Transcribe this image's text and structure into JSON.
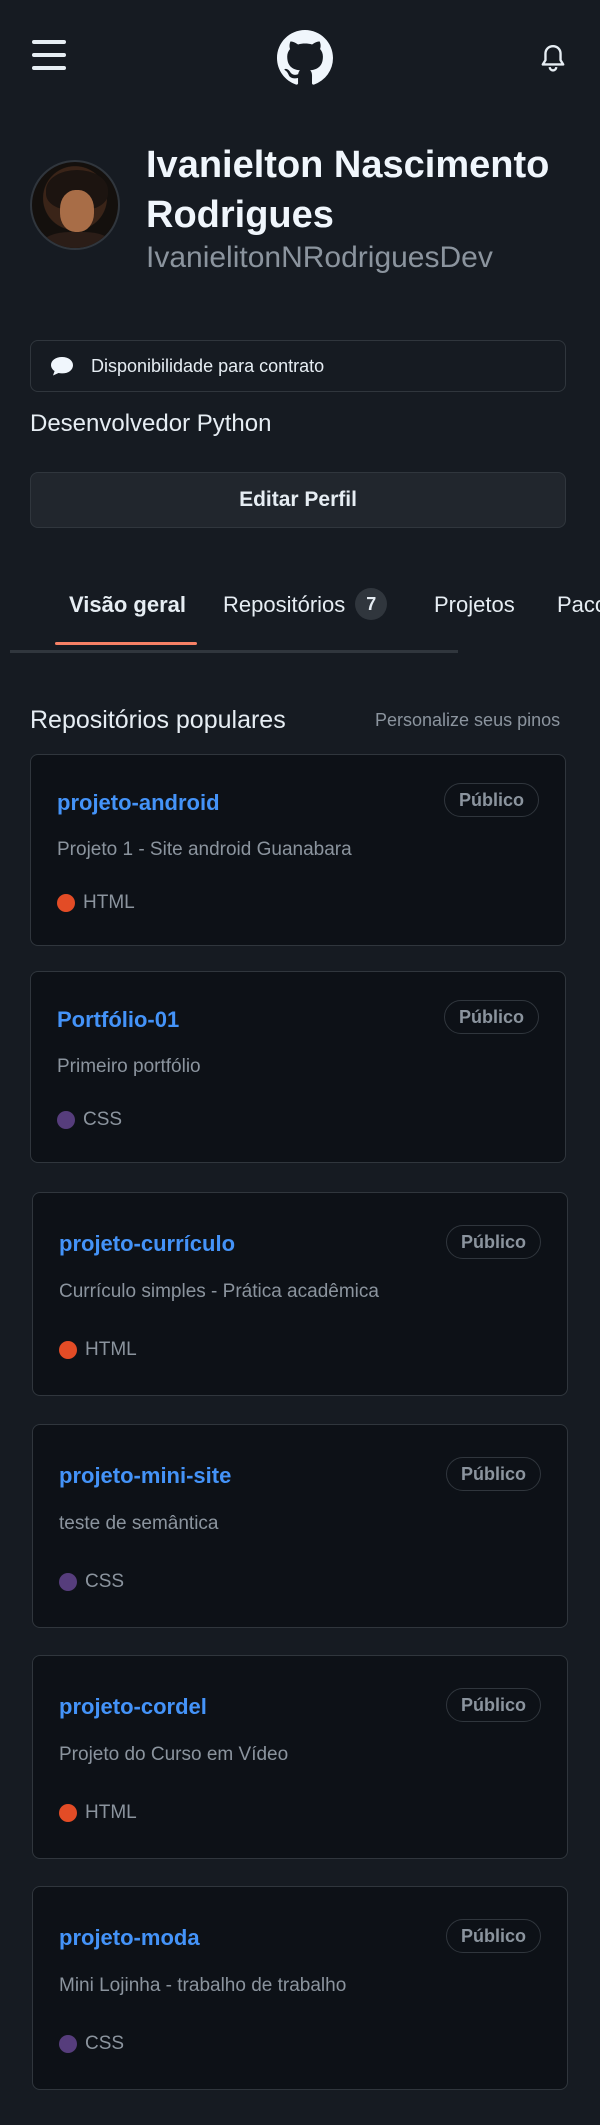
{
  "header": {
    "menu_icon": "hamburger-menu-icon",
    "logo_icon": "github-logo-icon",
    "notifications_icon": "bell-icon"
  },
  "profile": {
    "full_name": "Ivanielton Nascimento Rodrigues",
    "username": "IvanielitonNRodriguesDev",
    "hire_status": "Disponibilidade para contrato",
    "bio": "Desenvolvedor Python",
    "edit_label": "Editar Perfil"
  },
  "tabs": [
    {
      "label": "Visão geral",
      "active": true
    },
    {
      "label": "Repositórios",
      "count": "7"
    },
    {
      "label": "Projetos"
    },
    {
      "label": "Pacotes"
    }
  ],
  "section": {
    "title": "Repositórios populares",
    "customize": "Personalize seus pinos"
  },
  "colors": {
    "accent": "#f78166",
    "link": "#4493f8",
    "html": "#e34c26",
    "css": "#563d7c"
  },
  "repos": [
    {
      "name": "projeto-android",
      "visibility": "Público",
      "description": "Projeto 1 - Site android Guanabara",
      "language": "HTML",
      "lang_color": "#e34c26"
    },
    {
      "name": "Portfólio-01",
      "visibility": "Público",
      "description": "Primeiro portfólio",
      "language": "CSS",
      "lang_color": "#563d7c"
    },
    {
      "name": "projeto-currículo",
      "visibility": "Público",
      "description": "Currículo simples - Prática acadêmica",
      "language": "HTML",
      "lang_color": "#e34c26"
    },
    {
      "name": "projeto-mini-site",
      "visibility": "Público",
      "description": "teste de semântica",
      "language": "CSS",
      "lang_color": "#563d7c"
    },
    {
      "name": "projeto-cordel",
      "visibility": "Público",
      "description": "Projeto do Curso em Vídeo",
      "language": "HTML",
      "lang_color": "#e34c26"
    },
    {
      "name": "projeto-moda",
      "visibility": "Público",
      "description": "Mini Lojinha - trabalho de trabalho",
      "language": "CSS",
      "lang_color": "#563d7c"
    }
  ]
}
